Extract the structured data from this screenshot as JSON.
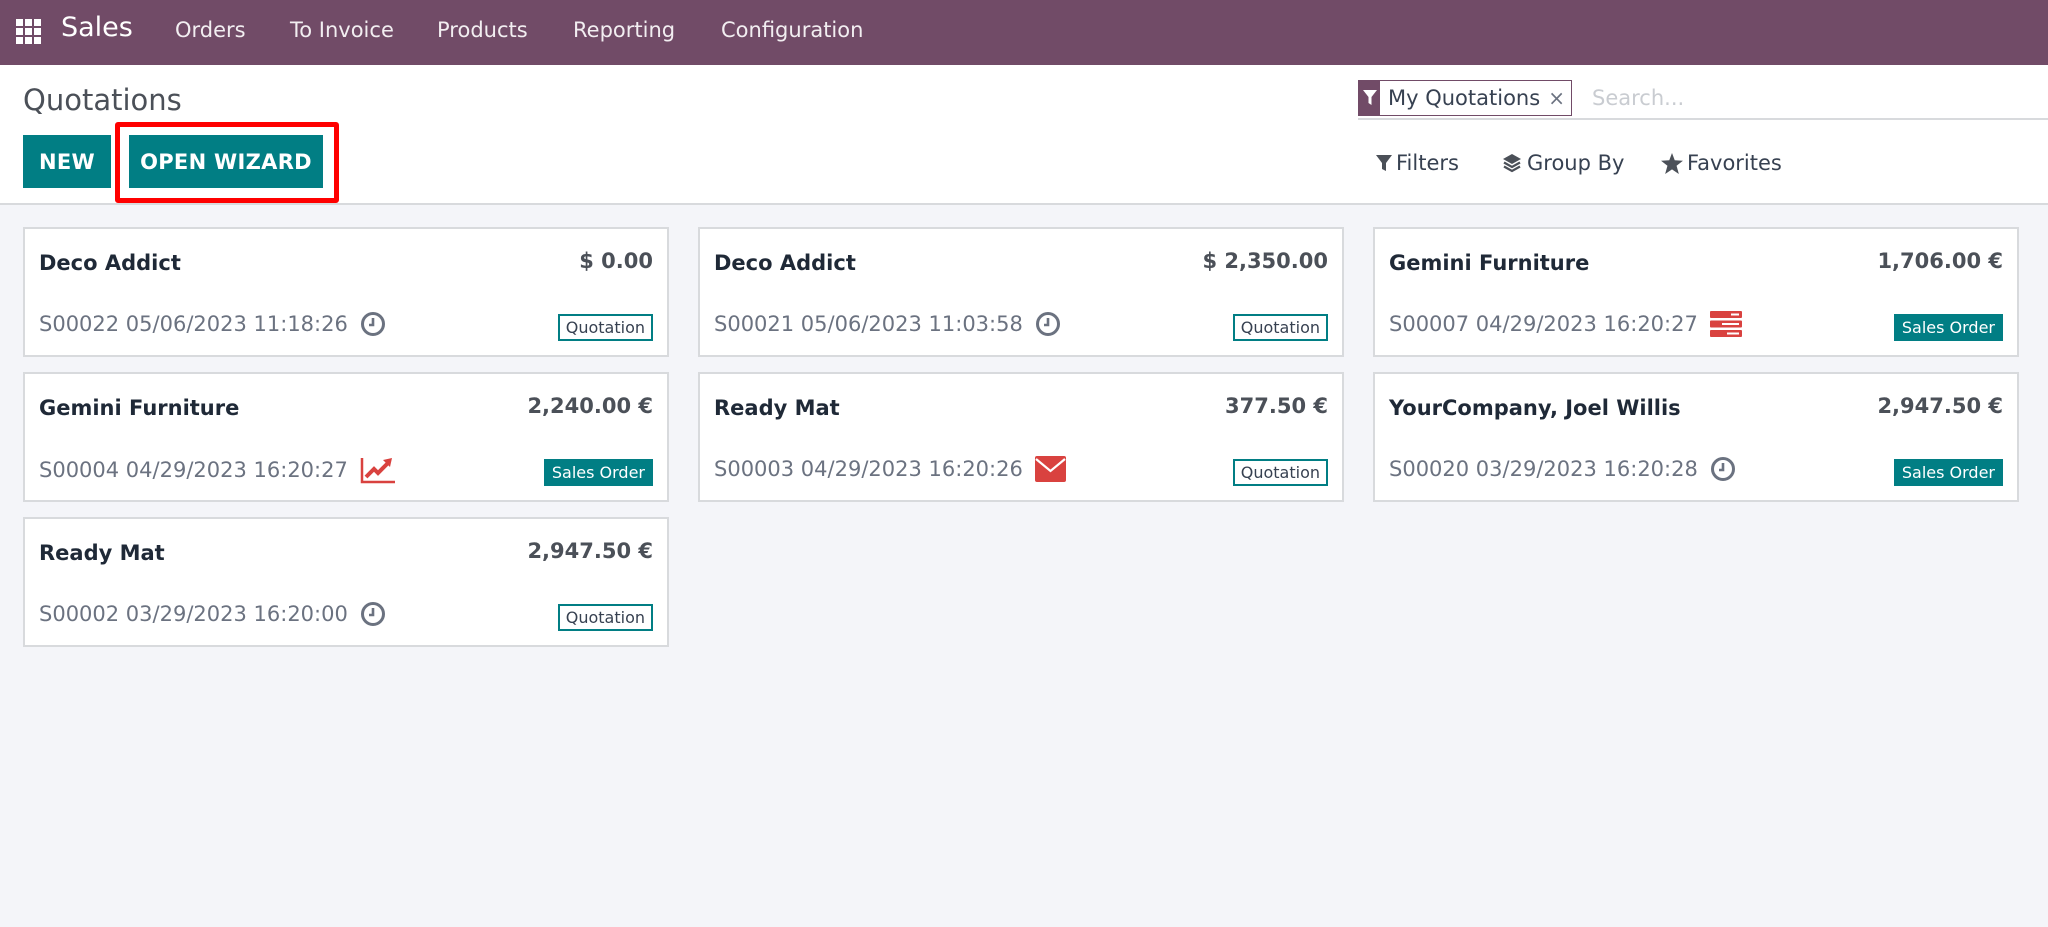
{
  "navbar": {
    "apps_icon": "apps-grid-icon",
    "brand": "Sales",
    "menu": [
      "Orders",
      "To Invoice",
      "Products",
      "Reporting",
      "Configuration"
    ]
  },
  "control_panel": {
    "title": "Quotations",
    "buttons": {
      "new": "NEW",
      "open_wizard": "OPEN WIZARD"
    },
    "search": {
      "facet_icon": "filter-icon",
      "facet_label": "My Quotations",
      "facet_remove": "×",
      "placeholder": "Search...",
      "value": ""
    },
    "togglers": [
      {
        "label": "Filters",
        "icon": "filter-icon"
      },
      {
        "label": "Group By",
        "icon": "layers-icon"
      },
      {
        "label": "Favorites",
        "icon": "star-icon"
      }
    ]
  },
  "colors": {
    "brand": "#714b67",
    "primary": "#017e84",
    "danger": "#d9423f",
    "highlight": "#ff0000"
  },
  "cards": [
    {
      "customer": "Deco Addict",
      "amount": "$ 0.00",
      "reference": "S00022 05/06/2023 11:18:26",
      "activity": "clock-icon",
      "status": "Quotation"
    },
    {
      "customer": "Deco Addict",
      "amount": "$ 2,350.00",
      "reference": "S00021 05/06/2023 11:03:58",
      "activity": "clock-icon",
      "status": "Quotation"
    },
    {
      "customer": "Gemini Furniture",
      "amount": "1,706.00 €",
      "reference": "S00007 04/29/2023 16:20:27",
      "activity": "tasks-icon",
      "status": "Sales Order"
    },
    {
      "customer": "Gemini Furniture",
      "amount": "2,240.00 €",
      "reference": "S00004 04/29/2023 16:20:27",
      "activity": "line-chart-icon",
      "status": "Sales Order"
    },
    {
      "customer": "Ready Mat",
      "amount": "377.50 €",
      "reference": "S00003 04/29/2023 16:20:26",
      "activity": "envelope-icon",
      "status": "Quotation"
    },
    {
      "customer": "YourCompany, Joel Willis",
      "amount": "2,947.50 €",
      "reference": "S00020 03/29/2023 16:20:28",
      "activity": "clock-icon",
      "status": "Sales Order"
    },
    {
      "customer": "Ready Mat",
      "amount": "2,947.50 €",
      "reference": "S00002 03/29/2023 16:20:00",
      "activity": "clock-icon",
      "status": "Quotation"
    }
  ]
}
